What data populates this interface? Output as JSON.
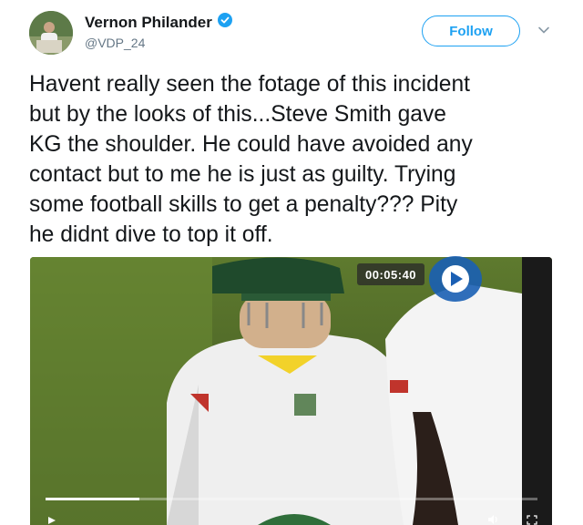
{
  "author": {
    "name": "Vernon Philander",
    "handle": "@VDP_24",
    "verified": true
  },
  "follow_label": "Follow",
  "tweet_text": "Havent really seen the fotage of this incident\nbut by the looks of this...Steve Smith gave\nKG the shoulder. He could have avoided any\ncontact but to me he is just as guilty. Trying\nsome football skills to get a penalty??? Pity\nhe didnt dive to top it off.",
  "video": {
    "timestamp": "00:05:40",
    "progress": 0.19
  },
  "colors": {
    "accent": "#1da1f2",
    "text": "#14171a",
    "secondary": "#657786"
  },
  "icons": [
    "verified-badge-icon",
    "chevron-down-icon",
    "play-icon",
    "volume-icon",
    "fullscreen-icon"
  ]
}
